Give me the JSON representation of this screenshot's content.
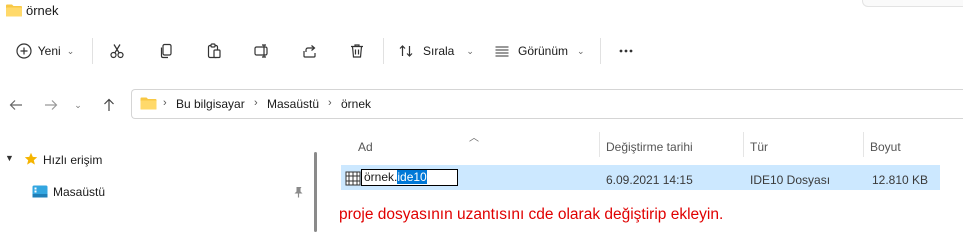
{
  "window": {
    "title": "örnek"
  },
  "toolbar": {
    "new_label": "Yeni",
    "sort_label": "Sırala",
    "view_label": "Görünüm",
    "icons": [
      "plus-circle-icon",
      "cut-icon",
      "copy-icon",
      "paste-icon",
      "rename-icon",
      "share-icon",
      "delete-icon",
      "sort-icon",
      "view-icon",
      "more-icon"
    ]
  },
  "breadcrumb": {
    "items": [
      "Bu bilgisayar",
      "Masaüstü",
      "örnek"
    ],
    "separator": "›"
  },
  "nav": {
    "quick_access": "Hızlı erişim",
    "desktop": "Masaüstü"
  },
  "columns": {
    "name": "Ad",
    "modified": "Değiştirme tarihi",
    "type": "Tür",
    "size": "Boyut"
  },
  "file": {
    "name_base": "örnek.",
    "name_ext_selected": "ide10",
    "modified": "6.09.2021 14:15",
    "type": "IDE10 Dosyası",
    "size": "12.810 KB"
  },
  "annotation": "proje dosyasının uzantısını cde olarak değiştirip ekleyin.",
  "colors": {
    "selection_row": "#cce8ff",
    "text_selection": "#0078d7",
    "annotation": "#e00000",
    "folder": "#f8c844"
  }
}
